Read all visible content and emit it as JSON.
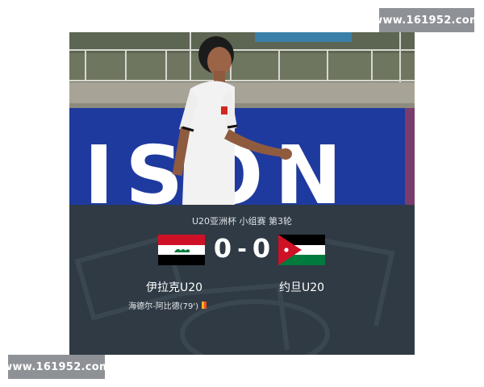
{
  "watermarks": {
    "top": "www.161952.com",
    "bottom": "www.161952.com"
  },
  "board_text": "ISON",
  "scoreboard": {
    "competition": "U20亚洲杯 小组赛 第3轮",
    "home": {
      "name": "伊拉克U20",
      "score": "0",
      "flag": "iraq-flag"
    },
    "away": {
      "name": "约旦U20",
      "score": "0",
      "flag": "jordan-flag"
    },
    "separator": "-",
    "events": [
      {
        "player_minute": "海德尔-阿比德(79')",
        "card": "yellow-red-card"
      }
    ]
  },
  "colors": {
    "panel": "#2f3a44",
    "board": "#1f3a9e",
    "card_red": "#f0521f",
    "card_yellow": "#f6b41e"
  }
}
